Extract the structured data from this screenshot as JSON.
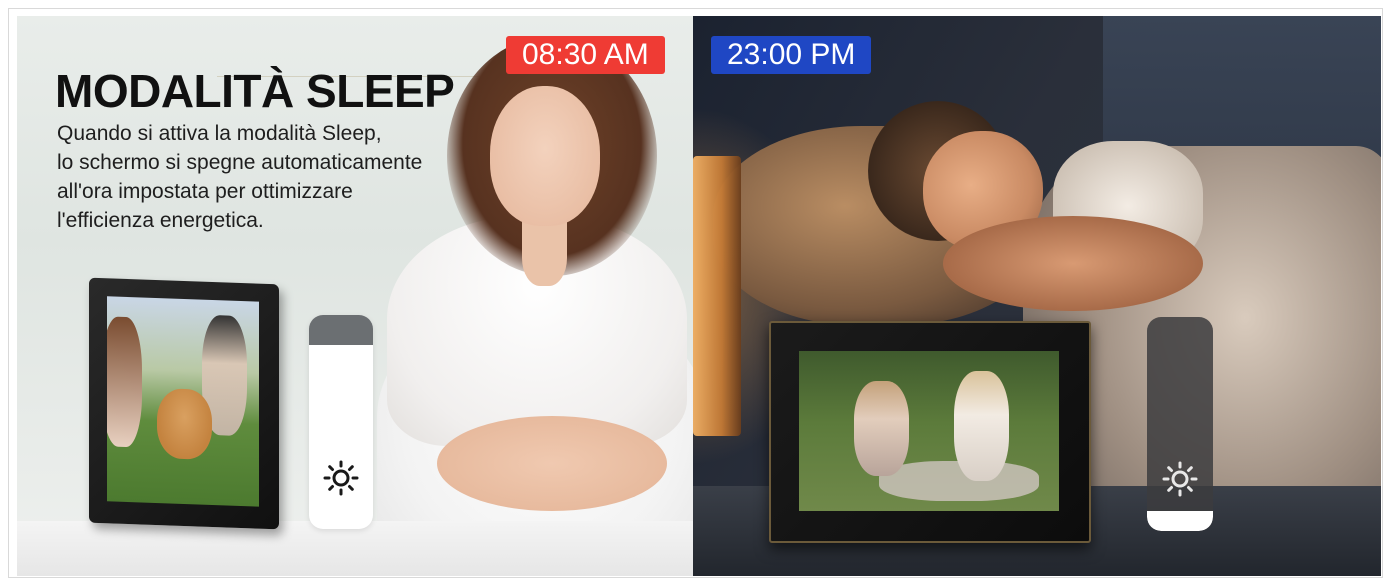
{
  "left_panel": {
    "time_badge": "08:30 AM",
    "headline": "MODALITÀ SLEEP",
    "description_lines": [
      "Quando si attiva la modalità Sleep,",
      "lo schermo si spegne automaticamente",
      "all'ora impostata per ottimizzare",
      "l'efficienza energetica."
    ],
    "brightness_icon": "sun-icon",
    "badge_color": "#ef3b34"
  },
  "right_panel": {
    "time_badge": "23:00 PM",
    "brightness_icon": "sun-icon",
    "badge_color": "#1f47c4"
  }
}
